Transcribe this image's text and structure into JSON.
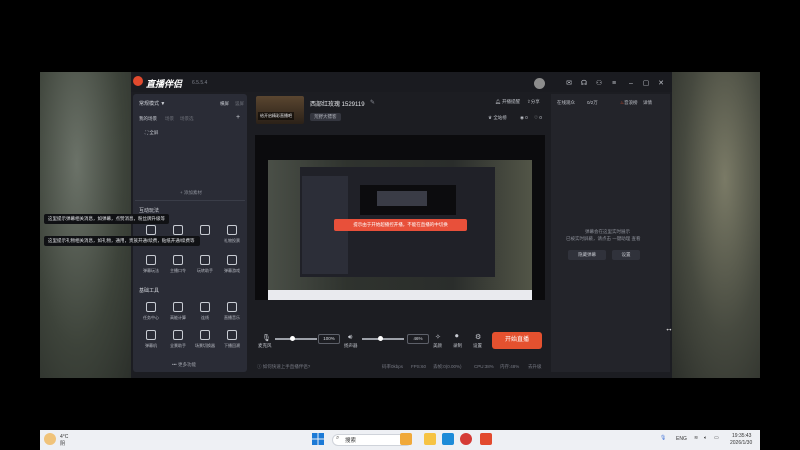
{
  "app": {
    "title": "直播伴侣",
    "version": "6.5.5.4"
  },
  "sidebar": {
    "mode_label": "常规模式",
    "mode_right": "横屏",
    "mode_right2": "竖屏",
    "scene_tabs": [
      "我的场景",
      "场景",
      "场景选"
    ],
    "scene_item": "全屏",
    "add_material": "+ 添加素材",
    "interact_title": "互动玩法",
    "interact_items": [
      "",
      "",
      "",
      "礼物投票"
    ],
    "interact_items2": [
      "弹幕玩法",
      "主播口令",
      "玩转助手",
      "弹幕游戏"
    ],
    "tools_title": "基础工具",
    "tools_items": [
      "任务中心",
      "高能计算",
      "连线",
      "直播音乐"
    ],
    "tools_items2": [
      "弹幕机",
      "全景助手",
      "场景切换器",
      "下播回溯"
    ],
    "more": "••• 更多功能"
  },
  "tooltips": [
    "这里提示弹幕相关消息，如弹幕，点赞消息，粉丝牌升级等",
    "这里提示礼物相关消息，如礼物，通用，贵族开通/续费，贴纸开通/续费等"
  ],
  "preview": {
    "thumb_label": "给开启精彩直播吧",
    "room_name": "西部红玫瑰 1529119",
    "tag": "荒野大镖客",
    "actions": [
      "开播提醒",
      "分享"
    ],
    "stats": [
      "全站榜",
      "0",
      "0"
    ]
  },
  "toast": "提示由于开始超播控开播，不能在直播的中切换",
  "controls": {
    "mic_label": "麦克风",
    "mic_value": "100%",
    "speaker_label": "扬声器",
    "speaker_value": "46%",
    "btns": [
      "美颜",
      "录制",
      "设置"
    ],
    "start_label": "开始直播"
  },
  "statusbar": {
    "left": "如何快速上手直播伴侣?",
    "right": [
      "码率0kbps",
      "FPS:60",
      "丢帧:0(0.00%)",
      "CPU:38%",
      "内存:48%",
      "去升级"
    ]
  },
  "chat": {
    "tabs": [
      "在线观众",
      "0/2万",
      "音浪榜",
      "详情"
    ],
    "message_line1": "弹幕会在这里实时展示",
    "message_line2": "已被实时屏蔽，请点击 一键助理 查看",
    "btns": [
      "隐藏弹幕",
      "设置"
    ]
  },
  "taskbar": {
    "weather": "4°C",
    "weather2": "阴",
    "search_placeholder": "搜索",
    "lang": "ENG",
    "time": "19:35:43",
    "date": "2026/1/30"
  },
  "colors": {
    "accent": "#e4512f",
    "panel": "#2a2c36",
    "bg": "#1c1d22"
  }
}
